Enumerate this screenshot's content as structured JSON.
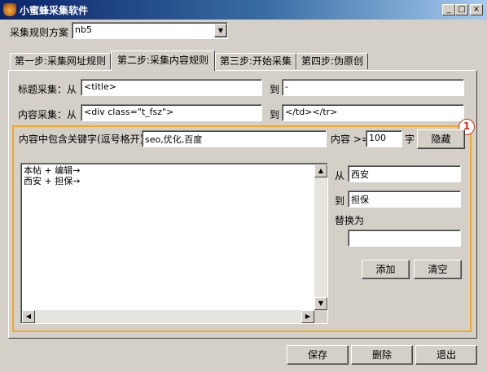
{
  "window": {
    "title": "小蜜蜂采集软件",
    "minimize_glyph": "_",
    "maximize_glyph": "□",
    "close_glyph": "×"
  },
  "scheme": {
    "label": "采集规则方案",
    "value": "nb5"
  },
  "tabs": [
    {
      "label": "第一步:采集网址规则"
    },
    {
      "label": "第二步:采集内容规则"
    },
    {
      "label": "第三步:开始采集"
    },
    {
      "label": "第四步:伪原创"
    }
  ],
  "title_capture": {
    "label": "标题采集：从",
    "from_value": "<title>",
    "to_label": "到",
    "to_value": "-"
  },
  "content_capture": {
    "label": "内容采集：从",
    "from_value": "<div class=\"t_fsz\">",
    "to_label": "到",
    "to_value": "</td></tr>"
  },
  "keywords": {
    "label": "内容中包含关键字(逗号格开)",
    "value": "seo,优化,百度",
    "length_label": "内容 >=",
    "length_value": "100",
    "unit_label": "字",
    "hide_button": "隐藏"
  },
  "badge": "1",
  "replace_list": [
    "本帖 + 编辑→",
    "西安 + 担保→"
  ],
  "replace_form": {
    "from_label": "从",
    "from_value": "西安",
    "to_label": "到",
    "to_value": "担保",
    "replace_label": "替换为",
    "replace_value": "",
    "add_button": "添加",
    "clear_button": "清空"
  },
  "footer": {
    "save": "保存",
    "delete": "删除",
    "exit": "退出"
  },
  "colors": {
    "highlight_frame": "#f5a623",
    "badge": "#d4321c",
    "titlebar_start": "#0a246a",
    "titlebar_end": "#a6caf0"
  }
}
